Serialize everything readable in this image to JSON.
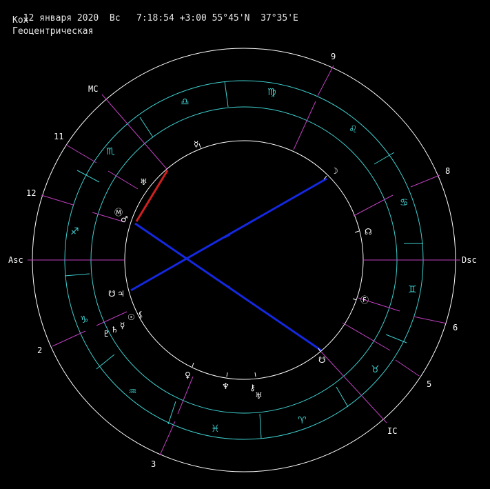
{
  "header": {
    "date": "12 января 2020",
    "weekday": "Вс",
    "time": "7:18:54 +3:00",
    "latitude": "55°45'N",
    "longitude": "37°35'E",
    "house_system": "Кох",
    "mode": "Геоцентрическая"
  },
  "axes": {
    "asc": "Asc",
    "dsc": "Dsc",
    "mc": "MC",
    "ic": "IC"
  },
  "houses": [
    {
      "label": "11"
    },
    {
      "label": "12"
    },
    {
      "label": "2"
    },
    {
      "label": "3"
    },
    {
      "label": "5"
    },
    {
      "label": "6"
    },
    {
      "label": "8"
    },
    {
      "label": "9"
    }
  ],
  "signs": [
    "♎",
    "♍",
    "♌",
    "♋",
    "♊",
    "♉",
    "♈",
    "♓",
    "♒",
    "♑",
    "♐",
    "♏"
  ],
  "planets": [
    {
      "name": "mercury",
      "glyph": "☿"
    },
    {
      "name": "moon",
      "glyph": "☽"
    },
    {
      "name": "node",
      "glyph": "☊"
    },
    {
      "name": "fortune",
      "glyph": "Ⓕ"
    },
    {
      "name": "south-node",
      "glyph": "☋"
    },
    {
      "name": "venus",
      "glyph": "♀"
    },
    {
      "name": "neptune",
      "glyph": "♆"
    },
    {
      "name": "chiron",
      "glyph": "⚷"
    },
    {
      "name": "uranus",
      "glyph": "♅"
    },
    {
      "name": "jupiter",
      "glyph": "♃"
    },
    {
      "name": "south-node-2",
      "glyph": "☋"
    },
    {
      "name": "sun",
      "glyph": "☉"
    },
    {
      "name": "mercury-2",
      "glyph": "☿"
    },
    {
      "name": "saturn",
      "glyph": "♄"
    },
    {
      "name": "pluto",
      "glyph": "♇"
    },
    {
      "name": "lilith",
      "glyph": "⚸"
    },
    {
      "name": "mars",
      "glyph": "♂"
    },
    {
      "name": "mc-point",
      "glyph": "Ⓜ"
    },
    {
      "name": "lilith-2",
      "glyph": "♅"
    }
  ],
  "colors": {
    "outer_circle": "#ffffff",
    "zodiac_ring": "#3fd0d0",
    "house_line": "#c040c0",
    "axis_line": "#c040c0",
    "aspect_blue": "#1428e0",
    "aspect_red": "#d02020"
  }
}
